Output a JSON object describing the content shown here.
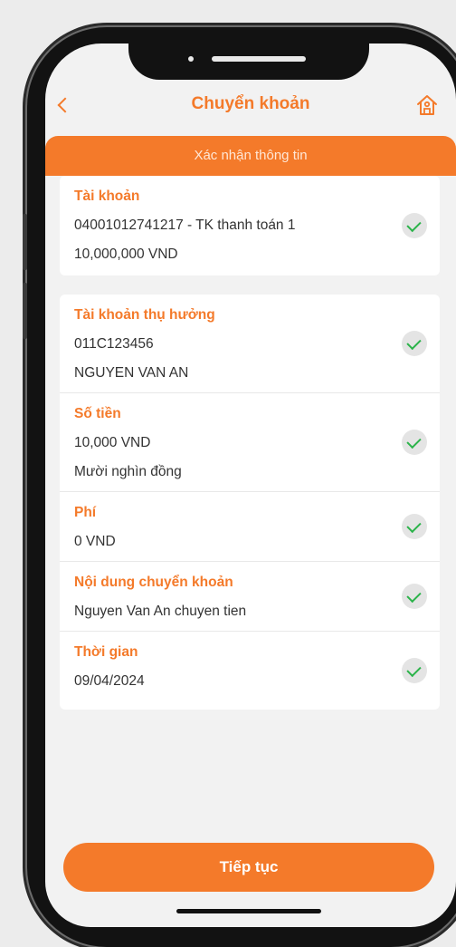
{
  "header": {
    "title": "Chuyển khoản",
    "back_icon": "chevron-left-icon",
    "home_icon": "home-icon"
  },
  "banner": {
    "label": "Xác nhận thông tin"
  },
  "account": {
    "label": "Tài khoản",
    "number_line": "04001012741217 - TK thanh toán 1",
    "balance": "10,000,000 VND"
  },
  "beneficiary": {
    "label": "Tài khoản thụ hưởng",
    "account_no": "011C123456",
    "name": "NGUYEN VAN AN"
  },
  "amount": {
    "label": "Số tiền",
    "value": "10,000 VND",
    "in_words": "Mười nghìn đồng"
  },
  "fee": {
    "label": "Phí",
    "value": "0 VND"
  },
  "content": {
    "label": "Nội dung chuyển khoản",
    "value": "Nguyen Van An chuyen tien"
  },
  "time": {
    "label": "Thời gian",
    "value": "09/04/2024"
  },
  "actions": {
    "continue_label": "Tiếp tục"
  },
  "colors": {
    "accent": "#f47a2a",
    "check": "#2bb34a",
    "background": "#f2f2f2"
  }
}
